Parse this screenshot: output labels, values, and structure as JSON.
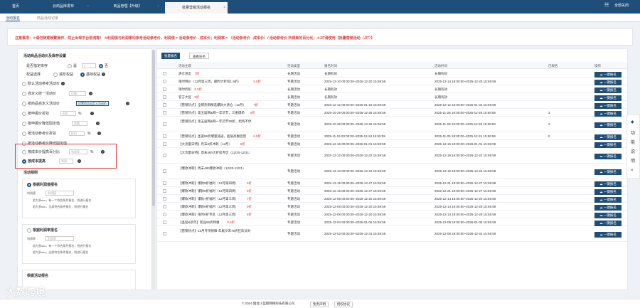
{
  "tabs": [
    {
      "label": "首页"
    },
    {
      "label": "云商品库发布"
    },
    {
      "label": "商品管理【升级】"
    },
    {
      "label": "批量营销活动报名"
    }
  ],
  "top_right": {
    "menu_icon": "grid-icon",
    "label": "全部关闭"
  },
  "subtabs": [
    "活动报名",
    "商品活动记录"
  ],
  "notice": "注意事项：①请勿随意频繁操作，防止出现平台限流等！ ②利润值与利润率均参考活动参考价，利润值 = 活动参考价 - 成本价；利润率 = （活动参考价 - 成本价）/ 活动参考价 所得到的百分比；③JIT请使用【批量营销活动（JIT）】",
  "left": {
    "title": "活动商品活动价及库存设置",
    "stock_label": "是否指定库存",
    "stock_value": "是",
    "stock_no": "否",
    "rights_label": "权益选择",
    "rights_opt1": "进阶权益",
    "rights_opt2": "基础权益",
    "options": [
      {
        "label": "默认活动参考活动价"
      },
      {
        "label": "自定义统一活动价",
        "ph": "价格"
      },
      {
        "label": "按商品自定义活动价",
        "tag": "设置商品自定义活动价"
      },
      {
        "label": "按申报价折扣",
        "ph": "折扣"
      },
      {
        "label": "按申报价降低固定值",
        "ph": "金额"
      },
      {
        "label": "按活动参考价折扣",
        "ph": "折扣"
      },
      {
        "label": "按活动参考价降低固定值",
        "ph": "金额"
      },
      {
        "label": "按成本价提高百分比",
        "ph": "利润率"
      },
      {
        "label": "按成本提高",
        "ph": "利润"
      }
    ],
    "rule_title": "活动规则",
    "card1": {
      "title": "根据利润值报名",
      "field": "利润值",
      "ph": "利润值",
      "unit": "元",
      "l1": "若为多sku，有一个符合条件报名，则进行报名",
      "l2": "若为多sku，全部符合条件报名，则进行报名"
    },
    "card2": {
      "title": "根据利润率报名",
      "field": "利润率",
      "ph": "利润率",
      "unit": "%",
      "l1": "若为多sku，有一个符合条件报名，则进行报名",
      "l2": "若为多sku，全部符合条件报名，则进行报名"
    },
    "card3": {
      "title": "根据活动报名"
    }
  },
  "toolbar": {
    "batch": "批量报名",
    "view": "查看任务"
  },
  "columns": [
    "活动主题",
    "活动类型",
    "报名时间",
    "活动时间",
    "已报名",
    "操作"
  ],
  "rows": [
    {
      "name": "清仓甩卖",
      "price": "7折",
      "type": "长期活动",
      "signup": "长期有效",
      "period": "长期有效",
      "count": "",
      "btn": "一键报名"
    },
    {
      "name": "限时特价（12月第三周，翻时大折扣1.5折）",
      "price": "5.5折",
      "type": "专题活动",
      "signup": "2025-12-10 00:00:00~2025-12-20 15:59:59",
      "period": "2025-12-14 19:00:00~2025-12-20 15:59:59",
      "count": "",
      "btn": "一键报名"
    },
    {
      "name": "限时折扣",
      "price": "8.5折",
      "type": "长期活动",
      "signup": "长期有效",
      "period": "长期有效",
      "count": "",
      "btn": "一键报名"
    },
    {
      "name": "官方大促",
      "price": "9折",
      "type": "长期活动",
      "signup": "长期有效",
      "period": "长期有效",
      "count": "",
      "btn": "一键报名"
    },
    {
      "name": "【营销热点】全网热销精选爆款大清仓（12月）",
      "price": "7折",
      "type": "专题活动",
      "signup": "2025-12-12 00:00:00~2026-01-16 15:59:59",
      "period": "2025-12-12 19:00:00~2026-01-01 15:59:59",
      "count": "",
      "btn": "一键报名"
    },
    {
      "name": "【营销热点】第五届网&网一年货节，三重爆单",
      "price": "8折",
      "type": "专题活动",
      "signup": "2025-10-29 00:00:00~2025-12-26 15:59:59",
      "period": "2025-11-28 19:00:00~2025-12-26 15:59:59",
      "count": "3",
      "btn": "一键报名"
    },
    {
      "name": "【营销热点】第五届网&网一年货节85折，抢购不停",
      "price": "8.5折",
      "type": "专题活动",
      "signup": "2025-10-29 00:00:00~2025-12-26 15:59:59",
      "period": "2025-11-28 19:00:00~2025-12-26 15:59:59",
      "count": "2",
      "btn": "一键报名"
    },
    {
      "name": "【营销热点】圣诞85折爆量速递，超值高惠回馈",
      "price": "6.5折",
      "type": "专题活动",
      "signup": "2025-11-19 00:00:00~2025-12-24 15:59:59",
      "period": "2025-11-25 19:00:00~2025-12-24 15:59:59",
      "count": "0",
      "btn": "一键报名"
    },
    {
      "name": "【大流量日特】月末6折冲刺（12月）",
      "price": "6折",
      "type": "专题活动",
      "signup": "2025-12-16 00:00:00~2026-01-01 15:59:59",
      "period": "2025-12-16 19:00:00~2026-01-01 15:59:59",
      "count": "",
      "btn": "一键报名"
    },
    {
      "name": "【大流量日特】周末48h大折扣专区（12/20-12/21）",
      "price": "6折",
      "type": "专题活动",
      "signup": "2025-12-12 00:00:00~2025-12-22 15:59:59",
      "period": "2025-12-19 19:00:00~2025-12-22 15:59:59",
      "count": "",
      "btn": "一键报名"
    },
    {
      "name": "【爆款冲刺】周末48h爆款冲刺（12/20-12/21）",
      "price": "8.5折",
      "type": "专题活动",
      "signup": "2025-12-13 00:00:00~2025-12-22 15:59:59",
      "period": "2025-12-19 19:00:00~2025-12-22 15:59:59",
      "count": "",
      "btn": "一键报名"
    },
    {
      "name": "【爆款冲刺】爆款9折福利（12月第四周）",
      "price": "9折",
      "type": "专题活动",
      "signup": "2025-12-15 00:00:00~2025-12-27 15:59:59",
      "period": "2025-12-21 19:00:00~2025-12-27 15:59:59",
      "count": "",
      "btn": "一键报名"
    },
    {
      "name": "【爆款冲刺】爆款8折福利（12月第四周）",
      "price": "8折",
      "type": "专题活动",
      "signup": "2025-12-15 00:00:00~2025-12-27 15:59:59",
      "period": "2025-12-21 19:00:00~2025-12-27 15:59:59",
      "count": "",
      "btn": "一键报名"
    },
    {
      "name": "【爆款冲刺】爆款7折福利（12月第三周）",
      "price": "7折",
      "type": "专题活动",
      "signup": "2025-12-08 00:00:00~2025-12-20 15:59:59",
      "period": "2025-12-14 19:00:00~2025-12-20 15:59:59",
      "count": "",
      "btn": "一键报名"
    },
    {
      "name": "【爆款冲刺】爆款9折福利（12月第三周）",
      "price": "9折",
      "type": "专题活动",
      "signup": "2025-12-08 00:00:00~2025-12-20 15:59:59",
      "period": "2025-12-14 19:00:00~2025-12-20 15:59:59",
      "count": "",
      "btn": "一键报名"
    },
    {
      "name": "【爆款冲刺】限时6折专区（12月第三周）",
      "price": "6折",
      "type": "专题活动",
      "signup": "2025-12-08 00:00:00~2025-12-20 15:59:59",
      "period": "2025-12-14 19:00:00~2025-12-20 15:59:59",
      "count": "",
      "btn": "一键报名"
    },
    {
      "name": "【圣诞&新年】新品85折特惠",
      "price": "8.5折",
      "type": "专题活动",
      "signup": "2025-12-04 00:00:00~2026-01-06 15:59:59",
      "period": "2025-12-08 19:00:00~2026-01-08 15:59:59",
      "count": "",
      "btn": "一键报名"
    },
    {
      "name": "【营销热点】12月专项保障-年尾岁末75折狂欢派对",
      "price": "",
      "type": "专题活动",
      "signup": "2025-12-03 00:00:00~2025-12-31 15:59:59",
      "period": "2025-12-08 19:00:00~2025-12-31 15:59:59",
      "count": "",
      "btn": "一键报名"
    }
  ],
  "sidefloat": [
    "功",
    "能",
    "说",
    "明",
    "×"
  ],
  "footer": {
    "copyright": "© 2024 烟台小蓝鲸网络科技有限公司",
    "b1": "免责声明",
    "b2": "授权协议"
  },
  "watermark": "大数跨境"
}
